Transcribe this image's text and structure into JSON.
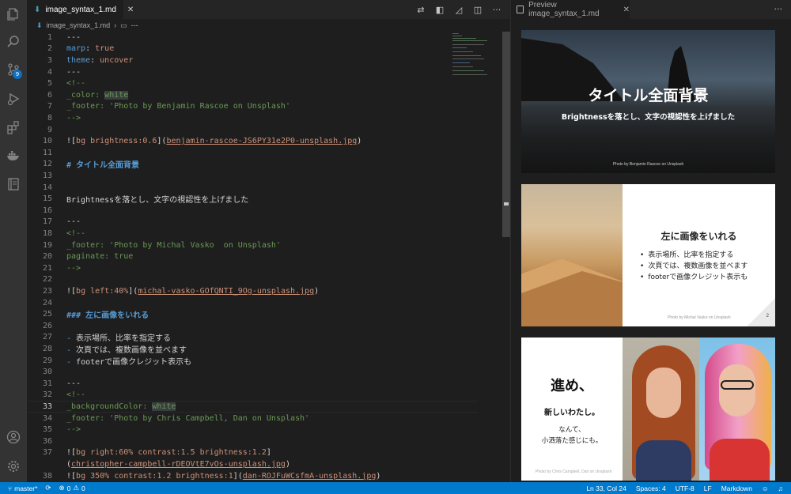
{
  "editor": {
    "tab_label": "image_syntax_1.md",
    "breadcrumb": {
      "file": "image_syntax_1.md",
      "symbol": "---"
    },
    "lines": [
      {
        "n": "1",
        "html": "---"
      },
      {
        "n": "2",
        "html": "<span class='k'>marp</span>: <span class='v'>true</span>"
      },
      {
        "n": "3",
        "html": "<span class='k'>theme</span>: <span class='v'>uncover</span>"
      },
      {
        "n": "4",
        "html": "---"
      },
      {
        "n": "5",
        "html": "<span class='c'>&lt;!--</span>"
      },
      {
        "n": "6",
        "html": "<span class='c'>_color: <span class='hl'>white</span></span>"
      },
      {
        "n": "7",
        "html": "<span class='c'>_footer: 'Photo by Benjamin Rascoe on Unsplash'</span>"
      },
      {
        "n": "8",
        "html": "<span class='c'>--&gt;</span>"
      },
      {
        "n": "9",
        "html": ""
      },
      {
        "n": "10",
        "html": "![<span class='v'>bg brightness:0.6</span>](<span class='u'>benjamin-rascoe-JS6PY31e2P0-unsplash.jpg</span>)"
      },
      {
        "n": "11",
        "html": ""
      },
      {
        "n": "12",
        "html": "<span class='h'># タイトル全面背景</span>"
      },
      {
        "n": "13",
        "html": ""
      },
      {
        "n": "14",
        "html": ""
      },
      {
        "n": "15",
        "html": "Brightnessを落とし、文字の視認性を上げました"
      },
      {
        "n": "16",
        "html": ""
      },
      {
        "n": "17",
        "html": "---"
      },
      {
        "n": "18",
        "html": "<span class='c'>&lt;!--</span>"
      },
      {
        "n": "19",
        "html": "<span class='c'>_footer: 'Photo by Michal Vasko  on Unsplash'</span>"
      },
      {
        "n": "20",
        "html": "<span class='c'>paginate: true</span>"
      },
      {
        "n": "21",
        "html": "<span class='c'>--&gt;</span>"
      },
      {
        "n": "22",
        "html": ""
      },
      {
        "n": "23",
        "html": "![<span class='v'>bg left:40%</span>](<span class='u'>michal-vasko-GOfQNTI_9Og-unsplash.jpg</span>)"
      },
      {
        "n": "24",
        "html": ""
      },
      {
        "n": "25",
        "html": "<span class='h'>### 左に画像をいれる</span>"
      },
      {
        "n": "26",
        "html": ""
      },
      {
        "n": "27",
        "html": "<span class='k'>-</span> 表示場所、比率を指定する"
      },
      {
        "n": "28",
        "html": "<span class='k'>-</span> 次頁では、複数画像を並べます"
      },
      {
        "n": "29",
        "html": "<span class='k'>-</span> footerで画像クレジット表示も"
      },
      {
        "n": "30",
        "html": ""
      },
      {
        "n": "31",
        "html": "---"
      },
      {
        "n": "32",
        "html": "<span class='c'>&lt;!--</span>"
      },
      {
        "n": "33",
        "html": "<span class='c'>_backgroundColor: <span class='hl'>white</span></span>"
      },
      {
        "n": "34",
        "html": "<span class='c'>_footer: 'Photo by Chris Campbell, Dan on Unsplash'</span>"
      },
      {
        "n": "35",
        "html": "<span class='c'>--&gt;</span>"
      },
      {
        "n": "36",
        "html": ""
      },
      {
        "n": "37",
        "html": "![<span class='v'>bg right:60% contrast:1.5 brightness:1.2</span>]"
      },
      {
        "n": "",
        "html": "(<span class='u'>christopher-campbell-rDEOVtE7vOs-unsplash.jpg</span>)"
      },
      {
        "n": "38",
        "html": "![<span class='v'>bg 350% contrast:1.2 brightness:1</span>](<span class='u'>dan-ROJFuWCsfmA-unsplash.jpg</span>)"
      }
    ]
  },
  "activity": {
    "scm_badge": "9"
  },
  "preview": {
    "tab_label": "Preview image_syntax_1.md",
    "slide1": {
      "title": "タイトル全面背景",
      "subtitle": "Brightnessを落とし、文字の視認性を上げました",
      "footer": "Photo by Benjamin Rascoe on Unsplash"
    },
    "slide2": {
      "title": "左に画像をいれる",
      "items": [
        "表示場所、比率を指定する",
        "次頁では、複数画像を並べます",
        "footerで画像クレジット表示も"
      ],
      "footer": "Photo by Michal Vasko   on Unsplash",
      "page": "2"
    },
    "slide3": {
      "title": "進め、",
      "subtitle": "新しいわたし。",
      "line1": "なんて、",
      "line2": "小洒落た感じにも。",
      "footer": "Photo by Chris Campbell, Dan on Unsplash"
    }
  },
  "status": {
    "branch": "master*",
    "errors": "0",
    "warnings": "0",
    "position": "Ln 33, Col 24",
    "spaces": "Spaces: 4",
    "encoding": "UTF-8",
    "eol": "LF",
    "language": "Markdown"
  }
}
